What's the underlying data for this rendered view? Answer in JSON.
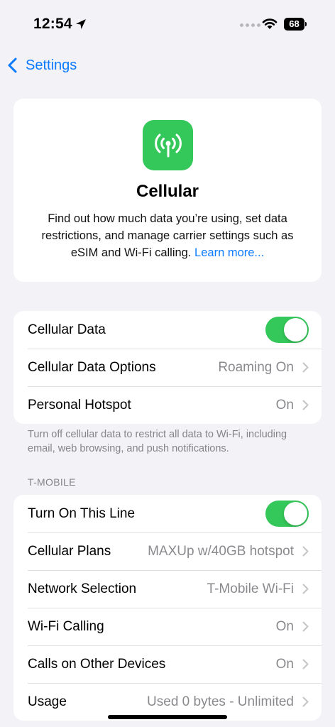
{
  "status_bar": {
    "time": "12:54",
    "battery_level": "68",
    "icons": [
      "location-arrow-icon",
      "signal-dots-icon",
      "wifi-icon",
      "battery-icon"
    ]
  },
  "nav": {
    "back_label": "Settings"
  },
  "hero": {
    "icon": "antenna-icon",
    "icon_bg_color": "#34c759",
    "title": "Cellular",
    "description": "Find out how much data you’re using, set data restrictions, and manage carrier settings such as eSIM and Wi-Fi calling.",
    "learn_more": "Learn more..."
  },
  "group1": {
    "rows": [
      {
        "label": "Cellular Data",
        "toggle": true
      },
      {
        "label": "Cellular Data Options",
        "value": "Roaming On"
      },
      {
        "label": "Personal Hotspot",
        "value": "On"
      }
    ],
    "footer": "Turn off cellular data to restrict all data to Wi-Fi, including email, web browsing, and push notifications."
  },
  "group2": {
    "header": "T-MOBILE",
    "rows": [
      {
        "label": "Turn On This Line",
        "toggle": true
      },
      {
        "label": "Cellular Plans",
        "value": "MAXUp w/40GB hotspot"
      },
      {
        "label": "Network Selection",
        "value": "T-Mobile Wi-Fi"
      },
      {
        "label": "Wi-Fi Calling",
        "value": "On"
      },
      {
        "label": "Calls on Other Devices",
        "value": "On"
      },
      {
        "label": "Usage",
        "value": "Used 0 bytes - Unlimited"
      }
    ]
  },
  "colors": {
    "accent": "#0a7aff",
    "toggle_on": "#34c759",
    "background": "#f2f2f7"
  }
}
